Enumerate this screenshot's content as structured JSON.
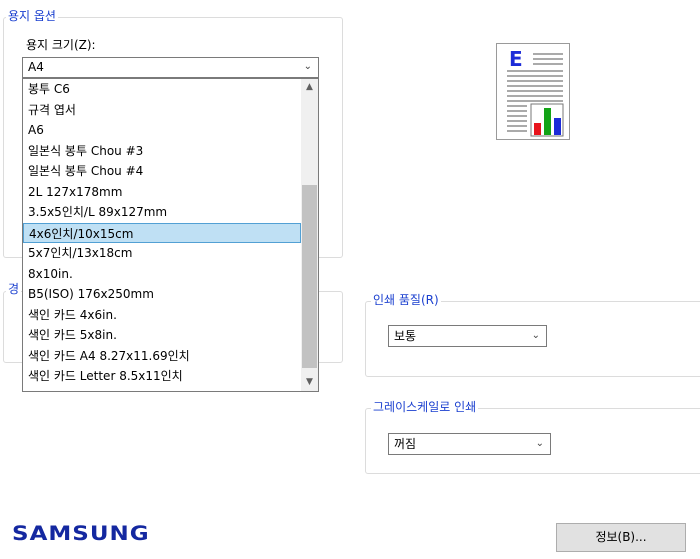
{
  "paper_options": {
    "legend": "용지 옵션",
    "size_label": "용지 크기(Z):",
    "size_value": "A4",
    "size_items": [
      "봉투 C6",
      "규격 엽서",
      "A6",
      "일본식 봉투 Chou #3",
      "일본식 봉투 Chou #4",
      "2L 127x178mm",
      "3.5x5인치/L 89x127mm",
      "4x6인치/10x15cm",
      "5x7인치/13x18cm",
      "8x10in.",
      "B5(ISO) 176x250mm",
      "색인 카드 4x6in.",
      "색인 카드 5x8in.",
      "색인 카드 A4 8.27x11.69인치",
      "색인 카드 Letter 8.5x11인치"
    ],
    "selected_index": 7
  },
  "hidden_group_legend_fragment": "경",
  "print_quality": {
    "legend": "인쇄 품질(R)",
    "value": "보통"
  },
  "grayscale": {
    "legend": "그레이스케일로 인쇄",
    "value": "꺼짐"
  },
  "preview_icon": {
    "icon": "document-preview-icon",
    "letter": "E",
    "bar_colors": [
      "#e8141c",
      "#13a316",
      "#1c2bd8"
    ]
  },
  "brand": {
    "logo_text": "SAMSUNG",
    "color": "#1428a0"
  },
  "info_button": {
    "label": "정보(B)..."
  }
}
